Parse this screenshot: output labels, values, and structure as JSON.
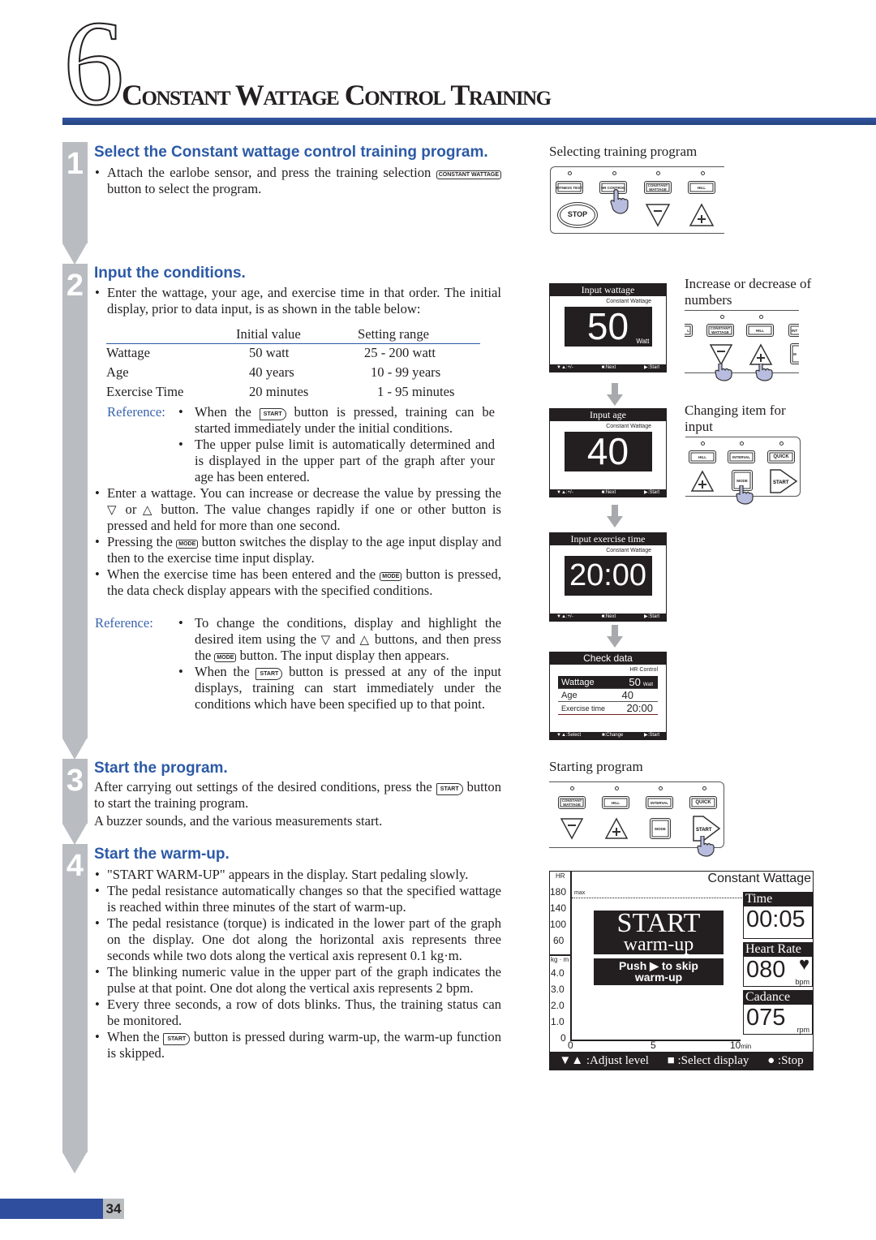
{
  "header": {
    "chapter": "6",
    "title": "Constant Wattage Control Training"
  },
  "steps": [
    {
      "num": "1",
      "heading": "Select the Constant wattage control training program.",
      "bullets": [
        [
          "Attach the earlobe sensor, and press the training selection ",
          {
            "btn": "CONSTANT WATTAGE"
          },
          " button to select the program."
        ]
      ]
    },
    {
      "num": "2",
      "heading": "Input the conditions.",
      "intro": [
        [
          "Enter the wattage, your age, and exercise time in that order. The initial display, prior to data input, is as shown in the table below:"
        ]
      ],
      "table": {
        "headers": [
          "",
          "Initial value",
          "Setting range"
        ],
        "rows": [
          [
            "Wattage",
            "50 watt",
            "25 - 200  watt"
          ],
          [
            "Age",
            "40  years",
            "10 - 99  years"
          ],
          [
            "Exercise Time",
            "20  minutes",
            "1 - 95  minutes"
          ]
        ]
      },
      "reference_label": "Reference:",
      "reference1": [
        [
          "When the ",
          {
            "btn": "START"
          },
          " button is pressed, training can be started immediately under the initial conditions."
        ],
        [
          "The upper pulse limit is automatically determined and is displayed in the upper part of the graph after your age has been entered."
        ]
      ],
      "bullets": [
        [
          "Enter a wattage. You can increase or decrease the value by pressing the ",
          {
            "tri": "▽"
          },
          " or ",
          {
            "tri": "△"
          },
          " button. The value changes rapidly if one or other button is pressed and held for more than one second."
        ],
        [
          "Pressing the ",
          {
            "btn": "MODE"
          },
          " button switches the display to the age input display and then to the exercise time input display."
        ],
        [
          "When the exercise time has been entered and the ",
          {
            "btn": "MODE"
          },
          " button is pressed, the data check display appears with the specified conditions."
        ]
      ],
      "reference2": [
        [
          "To change the conditions, display and highlight the desired item using the ",
          {
            "tri": "▽"
          },
          " and ",
          {
            "tri": "△"
          },
          " buttons, and then press the ",
          {
            "btn": "MODE"
          },
          " button. The input display then appears."
        ],
        [
          "When the ",
          {
            "btn": "START"
          },
          " button is pressed at any of the input displays, training can start immediately under the conditions which have been specified up to that point."
        ]
      ]
    },
    {
      "num": "3",
      "heading": "Start the program.",
      "paras": [
        [
          "After carrying out settings of the desired conditions, press the ",
          {
            "btn": "START"
          },
          " button to start the training program."
        ],
        [
          "A buzzer sounds, and the various measurements start."
        ]
      ]
    },
    {
      "num": "4",
      "heading": "Start the warm-up.",
      "bullets": [
        [
          "\"START WARM-UP\" appears in the display. Start pedaling slowly."
        ],
        [
          "The pedal resistance automatically changes so that the specified wattage is reached within three minutes of the start of warm-up."
        ],
        [
          "The pedal resistance (torque) is indicated in the lower part of the graph on the display. One dot along the horizontal axis represents three seconds while two dots along the vertical axis represent 0.1 kg·m."
        ],
        [
          "The blinking numeric value in the upper part of the graph indicates the pulse at that point. One dot along the vertical axis represents 2 bpm."
        ],
        [
          "Every three seconds, a row of dots blinks. Thus, the training status can be monitored."
        ],
        [
          "When the ",
          {
            "btn": "START"
          },
          " button is pressed during warm-up, the warm-up function is skipped."
        ]
      ]
    }
  ],
  "figures": {
    "select_label": "Selecting training program",
    "console1": {
      "buttons": [
        "FITNESS TEST",
        "HR CONTROL",
        "CONSTANT WATTAGE",
        "HILL"
      ],
      "stop": "STOP",
      "minus": "−",
      "plus": "+"
    },
    "screens": [
      {
        "title": "Input wattage",
        "sub": "Constant Wattage",
        "value": "50",
        "unit": "Watt",
        "foot": [
          "▼▲:+/-",
          "■:Next",
          "▶:Start"
        ]
      },
      {
        "title": "Input age",
        "sub": "Constant Wattage",
        "value": "40",
        "unit": "",
        "foot": [
          "▼▲:+/-",
          "■:Next",
          "▶:Start"
        ]
      },
      {
        "title": "Input exercise time",
        "sub": "Constant Wattage",
        "value": "20:00",
        "unit": "",
        "foot": [
          "▼▲:+/-",
          "■:Next",
          "▶:Start"
        ]
      }
    ],
    "check": {
      "title": "Check data",
      "sub": "HR Control",
      "rows": [
        [
          "Wattage",
          "50",
          "Watt"
        ],
        [
          "Age",
          "40",
          ""
        ],
        [
          "Exercise time",
          "20:00",
          ""
        ]
      ],
      "foot": [
        "▼▲:Select",
        "■:Change",
        "▶:Start"
      ]
    },
    "incdec_label": "Increase or decrease of numbers",
    "console2": {
      "buttons": [
        "L",
        "CONSTANT WATTAGE",
        "HILL",
        "INT",
        "M"
      ]
    },
    "change_label": "Changing item for input",
    "console3": {
      "buttons": [
        "HILL",
        "INTERVAL",
        "QUICK"
      ],
      "mode": "MODE",
      "start": "START"
    },
    "starting_label": "Starting program",
    "console4": {
      "buttons": [
        "CONSTANT WATTAGE",
        "HILL",
        "INTERVAL",
        "QUICK"
      ],
      "mode": "MODE",
      "start": "START"
    },
    "display": {
      "program": "Constant Wattage",
      "hr_label": "HR",
      "hr_ticks": [
        "180",
        "140",
        "100",
        "60"
      ],
      "kg_label": "kg · m",
      "kg_ticks": [
        "4.0",
        "3.0",
        "2.0",
        "1.0",
        "0"
      ],
      "x_ticks": [
        "0",
        "5",
        "10"
      ],
      "x_unit": "min",
      "max_label": "max",
      "start_big": "START",
      "start_small": "warm-up",
      "skip": "Push ▶ to skip",
      "skip2": "warm-up",
      "time_label": "Time",
      "time": "00:05",
      "hr_box_label": "Heart Rate",
      "hr": "080",
      "hr_unit": "bpm",
      "cad_label": "Cadance",
      "cad": "075",
      "cad_unit": "rpm",
      "foot": [
        "▼▲ :Adjust level",
        "■ :Select display",
        "● :Stop"
      ]
    }
  },
  "footer": {
    "page": "34"
  },
  "colors": {
    "accent": "#2c5aa6",
    "bar": "#b9bcc1",
    "header_bar": "#2f4f9e"
  }
}
